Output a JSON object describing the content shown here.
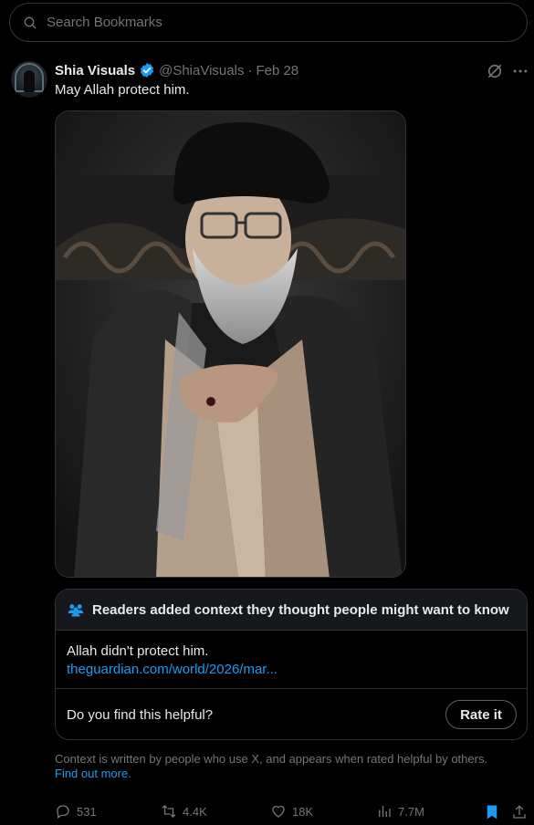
{
  "search": {
    "placeholder": "Search Bookmarks"
  },
  "tweet": {
    "author_name": "Shia Visuals",
    "handle": "@ShiaVisuals",
    "separator": "·",
    "date": "Feb 28",
    "text": "May Allah protect him."
  },
  "note": {
    "title": "Readers added context they thought people might want to know",
    "body": "Allah didn't protect him.",
    "link": "theguardian.com/world/2026/mar...",
    "helpful_question": "Do you find this helpful?",
    "rate_label": "Rate it"
  },
  "context": {
    "text": "Context is written by people who use X, and appears when rated helpful by others.",
    "link": "Find out more."
  },
  "actions": {
    "replies": "531",
    "reposts": "4.4K",
    "likes": "18K",
    "views": "7.7M"
  },
  "colors": {
    "accent": "#1d9bf0",
    "muted": "#71767b",
    "border": "#2f3336"
  }
}
